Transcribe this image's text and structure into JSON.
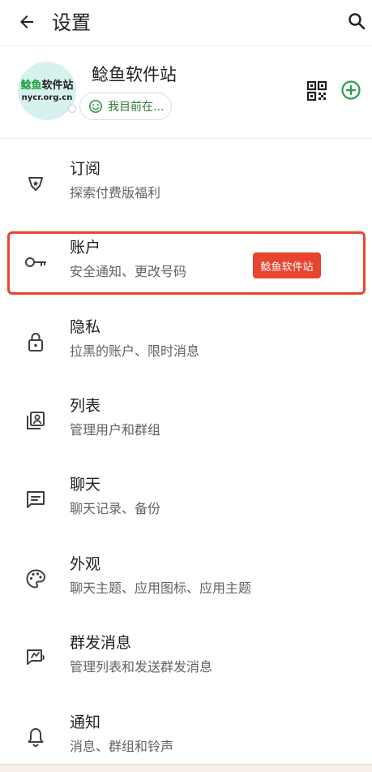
{
  "header": {
    "title": "设置"
  },
  "profile": {
    "name": "鲶鱼软件站",
    "status": "我目前在...",
    "avatar_line1_green": "鲶鱼",
    "avatar_line1_dark": "软件站",
    "avatar_line2": "nycr.org.cn"
  },
  "items": [
    {
      "label": "订阅",
      "sub": "探索付费版福利",
      "icon": "verified-badge-icon"
    },
    {
      "label": "账户",
      "sub": "安全通知、更改号码",
      "icon": "key-icon"
    },
    {
      "label": "隐私",
      "sub": "拉黑的账户、限时消息",
      "icon": "lock-icon"
    },
    {
      "label": "列表",
      "sub": "管理用户和群组",
      "icon": "contact-list-icon"
    },
    {
      "label": "聊天",
      "sub": "聊天记录、备份",
      "icon": "chat-icon"
    },
    {
      "label": "外观",
      "sub": "聊天主题、应用图标、应用主题",
      "icon": "palette-icon"
    },
    {
      "label": "群发消息",
      "sub": "管理列表和发送群发消息",
      "icon": "broadcast-icon"
    },
    {
      "label": "通知",
      "sub": "消息、群组和铃声",
      "icon": "bell-icon"
    }
  ],
  "watermark": "鲶鱼软件站",
  "colors": {
    "accent_green": "#2e9a4e",
    "highlight_red": "#e5472e"
  }
}
